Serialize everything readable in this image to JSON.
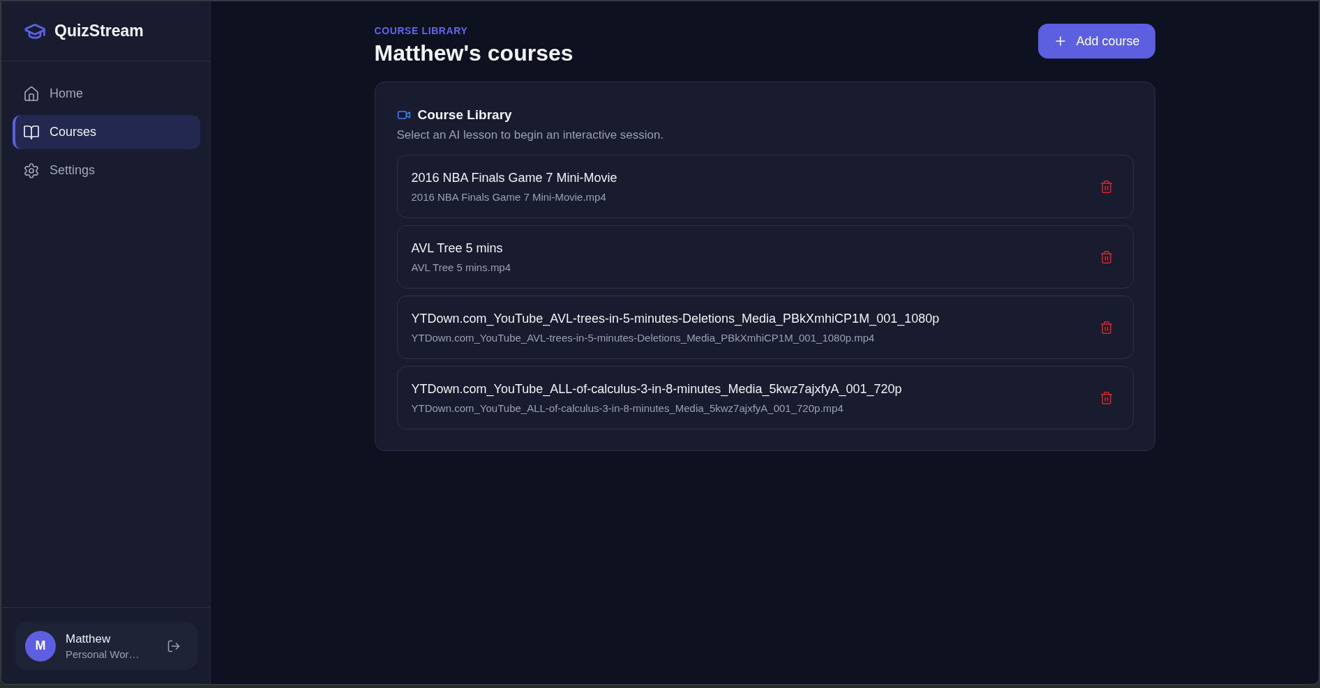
{
  "app": {
    "name": "QuizStream"
  },
  "sidebar": {
    "items": [
      {
        "label": "Home",
        "kind": "home",
        "selected": false
      },
      {
        "label": "Courses",
        "kind": "courses",
        "selected": true
      },
      {
        "label": "Settings",
        "kind": "settings",
        "selected": false
      }
    ]
  },
  "user": {
    "initial": "M",
    "name": "Matthew",
    "workspace": "Personal Wor…"
  },
  "header": {
    "eyebrow": "COURSE LIBRARY",
    "title": "Matthew's courses",
    "add_button": "Add course"
  },
  "library": {
    "title": "Course Library",
    "subtitle": "Select an AI lesson to begin an interactive session.",
    "courses": [
      {
        "title": "2016 NBA Finals Game 7 Mini-Movie",
        "file": "2016 NBA Finals Game 7 Mini-Movie.mp4"
      },
      {
        "title": "AVL Tree 5 mins",
        "file": "AVL Tree 5 mins.mp4"
      },
      {
        "title": "YTDown.com_YouTube_AVL-trees-in-5-minutes-Deletions_Media_PBkXmhiCP1M_001_1080p",
        "file": "YTDown.com_YouTube_AVL-trees-in-5-minutes-Deletions_Media_PBkXmhiCP1M_001_1080p.mp4"
      },
      {
        "title": "YTDown.com_YouTube_ALL-of-calculus-3-in-8-minutes_Media_5kwz7ajxfyA_001_720p",
        "file": "YTDown.com_YouTube_ALL-of-calculus-3-in-8-minutes_Media_5kwz7ajxfyA_001_720p.mp4"
      }
    ]
  }
}
